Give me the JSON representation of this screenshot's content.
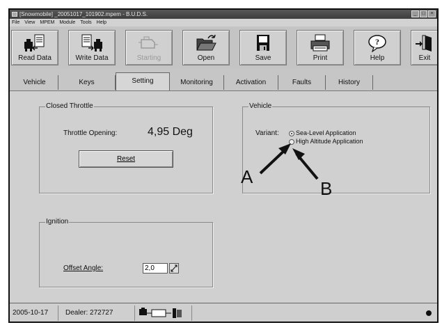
{
  "window": {
    "title": "[Snowmobile] _20051017_101902.mpem - B.U.D.S."
  },
  "menu": [
    "File",
    "View",
    "MPEM",
    "Module",
    "Tools",
    "Help"
  ],
  "toolbar": {
    "buttons": [
      {
        "label": "Read Data",
        "icon": "read-data-icon"
      },
      {
        "label": "Write Data",
        "icon": "write-data-icon"
      },
      {
        "label": "Starting",
        "icon": "engine-icon"
      },
      {
        "label": "Open",
        "icon": "folder-open-icon"
      },
      {
        "label": "Save",
        "icon": "floppy-disk-icon"
      },
      {
        "label": "Print",
        "icon": "printer-icon"
      },
      {
        "label": "Help",
        "icon": "help-icon"
      },
      {
        "label": "Exit",
        "icon": "exit-door-icon"
      }
    ]
  },
  "tabs": [
    "Vehicle",
    "Keys",
    "Setting",
    "Monitoring",
    "Activation",
    "Faults",
    "History"
  ],
  "active_tab": "Setting",
  "closed_throttle": {
    "title": "Closed Throttle",
    "opening_label": "Throttle Opening:",
    "opening_value": "4,95 Deg",
    "reset_label": "Reset"
  },
  "vehicle_group": {
    "title": "Vehicle",
    "variant_label": "Variant:",
    "options": [
      "Sea-Level Application",
      "High Altitude Application"
    ],
    "selected": "Sea-Level Application"
  },
  "ignition": {
    "title": "Ignition",
    "offset_label": "Offset Angle:",
    "offset_value": "2,0"
  },
  "callouts": {
    "a": "A",
    "b": "B"
  },
  "status": {
    "date": "2005-10-17",
    "dealer": "Dealer: 272727"
  }
}
